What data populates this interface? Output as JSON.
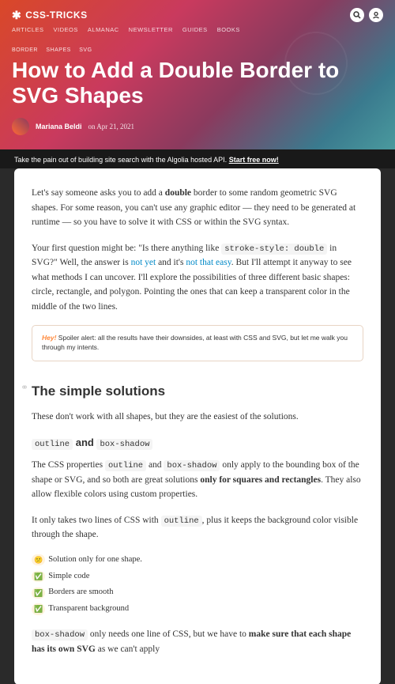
{
  "logo": "CSS-TRICKS",
  "nav": [
    "ARTICLES",
    "VIDEOS",
    "ALMANAC",
    "NEWSLETTER",
    "GUIDES",
    "BOOKS"
  ],
  "crumbs": [
    "BORDER",
    "SHAPES",
    "SVG"
  ],
  "title": "How to Add a Double Border to SVG Shapes",
  "author": "Mariana Beldi",
  "date_prefix": "on",
  "date": "Apr 21, 2021",
  "promo": {
    "text": "Take the pain out of building site search with the Algolia hosted API. ",
    "cta": "Start free now!"
  },
  "intro": {
    "p1a": "Let's say someone asks you to add a ",
    "p1b": "double",
    "p1c": " border to some random geometric SVG shapes. For some reason, you can't use any graphic editor — they need to be generated at runtime — so you have to solve it with CSS or within the SVG syntax.",
    "p2a": "Your first question might be: \"Is there anything like ",
    "p2code": "stroke-style: double",
    "p2b": " in SVG?\" Well, the answer is ",
    "p2link1": "not yet",
    "p2c": " and it's ",
    "p2link2": "not that easy",
    "p2d": ". But I'll attempt it anyway to see what methods I can uncover. I'll explore the possibilities of three different basic shapes: circle, rectangle, and polygon. Pointing the ones that can keep a transparent color in the middle of the two lines."
  },
  "callout": {
    "hey": "Hey!",
    "text": " Spoiler alert: all the results have their downsides, at least with CSS and SVG, but let me walk you through my intents."
  },
  "h2": "The simple solutions",
  "h2_sub": "These don't work with all shapes, but they are the easiest of the solutions.",
  "h3": {
    "c1": "outline",
    "and": " and ",
    "c2": "box-shadow"
  },
  "sec": {
    "p1a": "The CSS properties ",
    "c1": "outline",
    "p1b": " and ",
    "c2": "box-shadow",
    "p1c": " only apply to the bounding box of the shape or SVG, and so both are great solutions ",
    "p1d": "only for squares and rectangles",
    "p1e": ". They also allow flexible colors using custom properties.",
    "p2a": "It only takes two lines of CSS with ",
    "c3": "outline",
    "p2b": ", plus it keeps the background color visible through the shape."
  },
  "pills": [
    {
      "emoji": "😕",
      "text": "Solution only for one shape."
    },
    {
      "emoji": "✅",
      "text": "Simple code"
    },
    {
      "emoji": "✅",
      "text": "Borders are smooth"
    },
    {
      "emoji": "✅",
      "text": "Transparent background"
    }
  ],
  "tail": {
    "c1": "box-shadow",
    "a": " only needs one line of CSS, but we have to ",
    "b": "make sure that each shape has its own SVG",
    "c": " as we can't apply "
  }
}
